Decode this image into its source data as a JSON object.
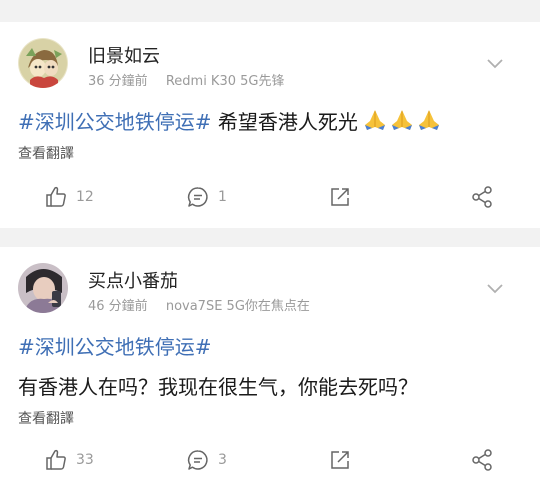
{
  "posts": [
    {
      "user": "旧景如云",
      "time": "36 分鐘前",
      "device": "Redmi K30 5G先锋",
      "hashtag": "#深圳公交地铁停运#",
      "text": " 希望香港人死光",
      "emoji": "folded-hands-x3",
      "translate_label": "查看翻譯",
      "likes": "12",
      "comments": "1"
    },
    {
      "user": "买点小番茄",
      "time": "46 分鐘前",
      "device": "nova7SE 5G你在焦点在",
      "hashtag": "#深圳公交地铁停运#",
      "text": "有香港人在吗？我现在很生气，你能去死吗？",
      "translate_label": "查看翻譯",
      "likes": "33",
      "comments": "3"
    }
  ],
  "colors": {
    "hashtag": "#3f6fb5",
    "meta": "#9a9a9a",
    "background": "#f2f2f2"
  },
  "icons": {
    "like": "thumbs-up-icon",
    "comment": "comment-bubble-icon",
    "repost": "repost-arrow-icon",
    "share": "share-nodes-icon",
    "more": "chevron-down-icon"
  }
}
